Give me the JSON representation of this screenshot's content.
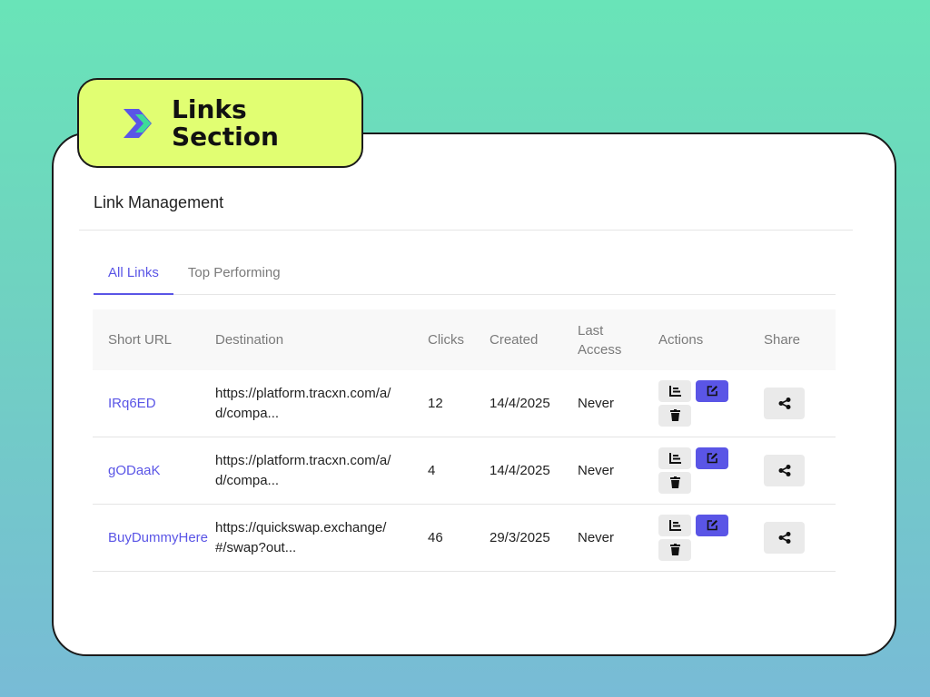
{
  "badge": {
    "title_line1": "Links",
    "title_line2": "Section",
    "logo_icon": "double-chevron-right-icon",
    "colors": {
      "badge_bg": "#e1fe72",
      "logo_primary": "#5a55e6",
      "logo_accent": "#3ddc97"
    }
  },
  "page": {
    "heading": "Link Management"
  },
  "tabs": [
    {
      "label": "All Links",
      "active": true
    },
    {
      "label": "Top Performing",
      "active": false
    }
  ],
  "table": {
    "headers": {
      "short_url": "Short URL",
      "destination": "Destination",
      "clicks": "Clicks",
      "created": "Created",
      "last_access_1": "Last",
      "last_access_2": "Access",
      "actions": "Actions",
      "share": "Share"
    },
    "rows": [
      {
        "short_url": "IRq6ED",
        "destination": "https://platform.tracxn.com/a/d/compa...",
        "clicks": "12",
        "created": "14/4/2025",
        "last_access": "Never"
      },
      {
        "short_url": "gODaaK",
        "destination": "https://platform.tracxn.com/a/d/compa...",
        "clicks": "4",
        "created": "14/4/2025",
        "last_access": "Never"
      },
      {
        "short_url": "BuyDummyHere",
        "destination": "https://quickswap.exchange/#/swap?out...",
        "clicks": "46",
        "created": "29/3/2025",
        "last_access": "Never"
      }
    ],
    "action_icons": {
      "stats": "bar-chart-icon",
      "edit": "edit-icon",
      "delete": "trash-icon",
      "share": "share-icon"
    }
  },
  "colors": {
    "accent": "#5a55e6",
    "card_bg": "#ffffff",
    "header_bg": "#f8f8f8"
  }
}
